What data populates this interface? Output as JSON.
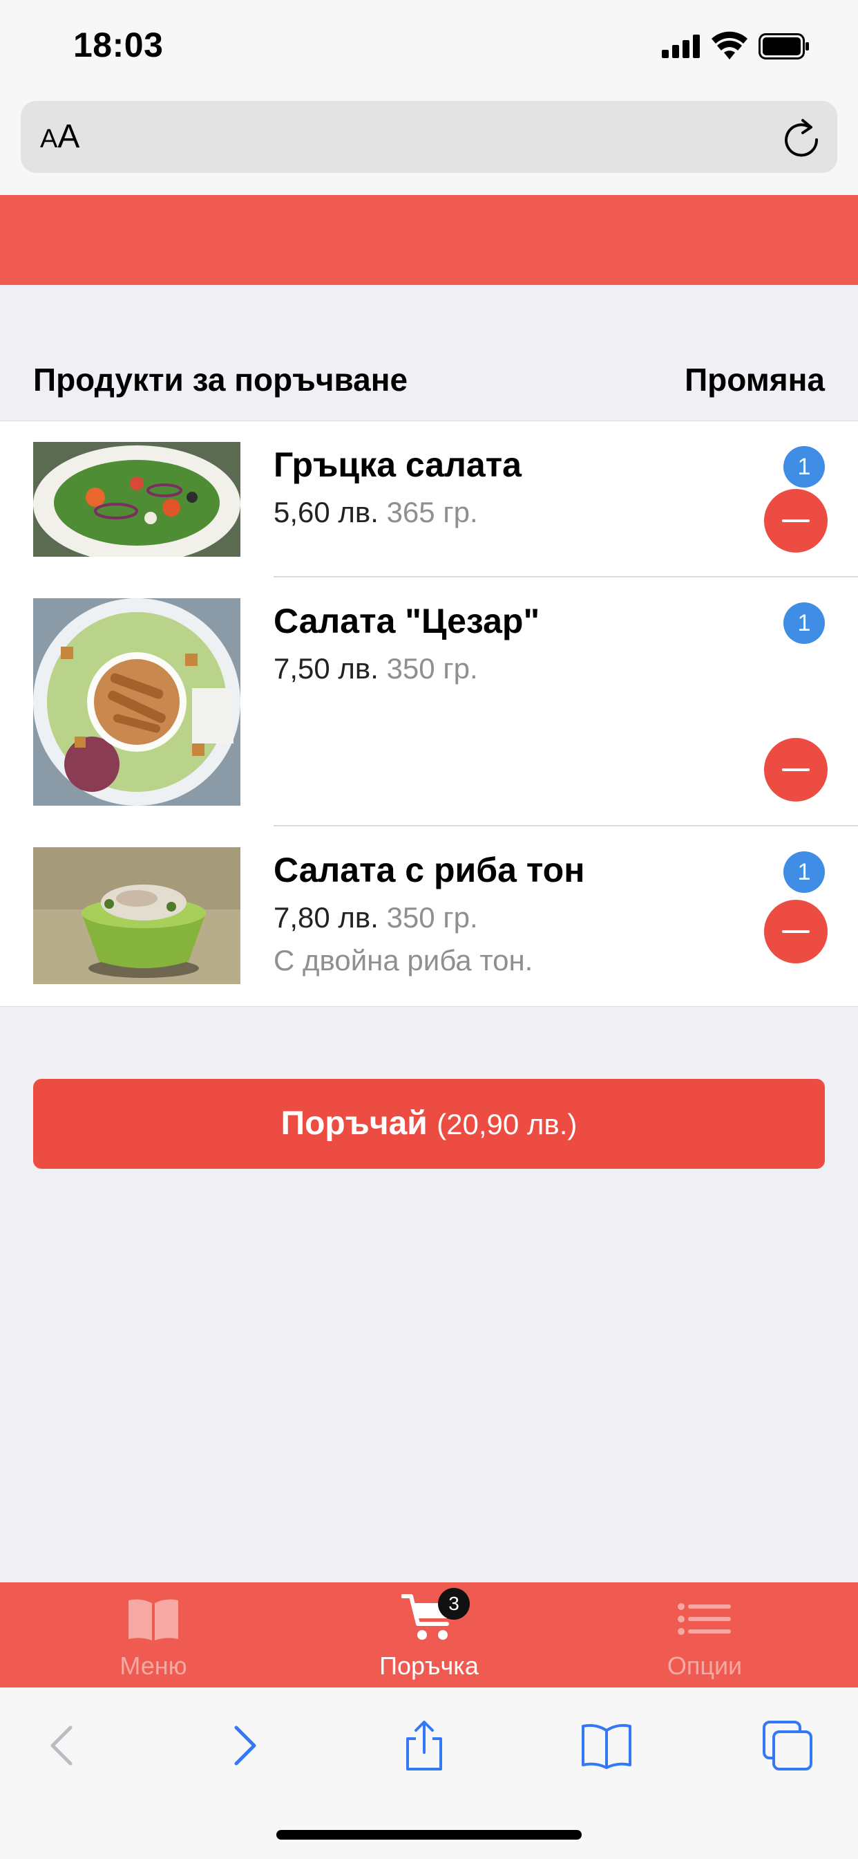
{
  "status_bar": {
    "time": "18:03"
  },
  "browser": {
    "aa_small": "A",
    "aa_large": "A"
  },
  "section": {
    "title": "Продукти за поръчване",
    "change_label": "Промяна"
  },
  "items": [
    {
      "name": "Гръцка салата",
      "price": "5,60 лв.",
      "weight": "365 гр.",
      "note": "",
      "qty": "1"
    },
    {
      "name": "Салата \"Цезар\"",
      "price": "7,50 лв.",
      "weight": "350 гр.",
      "note": "",
      "qty": "1"
    },
    {
      "name": "Салата с риба тон",
      "price": "7,80 лв.",
      "weight": "350 гр.",
      "note": "С двойна риба тон.",
      "qty": "1"
    }
  ],
  "order_button": {
    "label": "Поръчай",
    "total": "(20,90 лв.)"
  },
  "tabs": [
    {
      "label": "Меню",
      "icon": "book-icon",
      "active": false
    },
    {
      "label": "Поръчка",
      "icon": "cart-icon",
      "active": true,
      "badge": "3"
    },
    {
      "label": "Опции",
      "icon": "list-icon",
      "active": false
    }
  ],
  "colors": {
    "accent": "#ef5b50",
    "button": "#ec4c42",
    "badge_blue": "#3f8de5",
    "safari_blue": "#3478f6"
  }
}
